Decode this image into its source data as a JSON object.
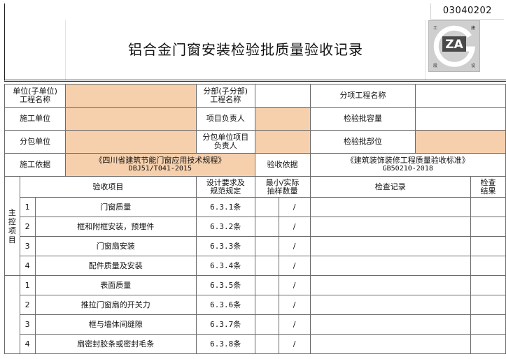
{
  "header": {
    "doc_code": "03040202",
    "title": "铝合金门窗安装检验批质量验收记录",
    "logo": {
      "text": "ZA",
      "corner_chars": [
        "工",
        "建",
        "段",
        "设"
      ]
    }
  },
  "info": {
    "unit_project_label": "单位(子单位)\n工程名称",
    "division_project_label": "分部(子分部)\n工程名称",
    "subdivision_label": "分项工程名称",
    "construction_unit_label": "施工单位",
    "project_manager_label": "项目负责人",
    "batch_capacity_label": "检验批容量",
    "subcontractor_label": "分包单位",
    "subcontract_manager_label": "分包单位项目\n负责人",
    "batch_location_label": "检验批部位",
    "construction_basis_label": "施工依据",
    "construction_basis_line1": "《四川省建筑节能门窗应用技术规程》",
    "construction_basis_line2": "DBJ51/T041-2015",
    "acceptance_basis_label": "验收依据",
    "acceptance_basis_line1": "《建筑装饰装修工程质量验收标准》",
    "acceptance_basis_line2": "GB50210-2018"
  },
  "columns": {
    "item": "验收项目",
    "design": "设计要求及\n规范规定",
    "sample": "最小/实际\n抽样数量",
    "record": "检查记录",
    "result": "检查\n结果"
  },
  "main_control": {
    "label": "主\n控\n项\n目",
    "items": [
      {
        "no": "1",
        "name": "门窗质量",
        "clause": "6.3.1条",
        "sample": "/"
      },
      {
        "no": "2",
        "name": "框和附框安装，预埋件",
        "clause": "6.3.2条",
        "sample": "/"
      },
      {
        "no": "3",
        "name": "门窗扇安装",
        "clause": "6.3.3条",
        "sample": "/"
      },
      {
        "no": "4",
        "name": "配件质量及安装",
        "clause": "6.3.4条",
        "sample": "/"
      }
    ]
  },
  "general": {
    "items": [
      {
        "no": "1",
        "name": "表面质量",
        "clause": "6.3.5条",
        "sample": "/"
      },
      {
        "no": "2",
        "name": "推拉门窗扇的开关力",
        "clause": "6.3.6条",
        "sample": "/"
      },
      {
        "no": "3",
        "name": "框与墙体间缝隙",
        "clause": "6.3.7条",
        "sample": "/"
      },
      {
        "no": "4",
        "name": "扇密封胶条或密封毛条",
        "clause": "6.3.8条",
        "sample": "/"
      }
    ]
  },
  "colors": {
    "highlight": "#f6d0ad",
    "border": "#6b6b6b",
    "logo_bg": "#cfcfcf"
  }
}
